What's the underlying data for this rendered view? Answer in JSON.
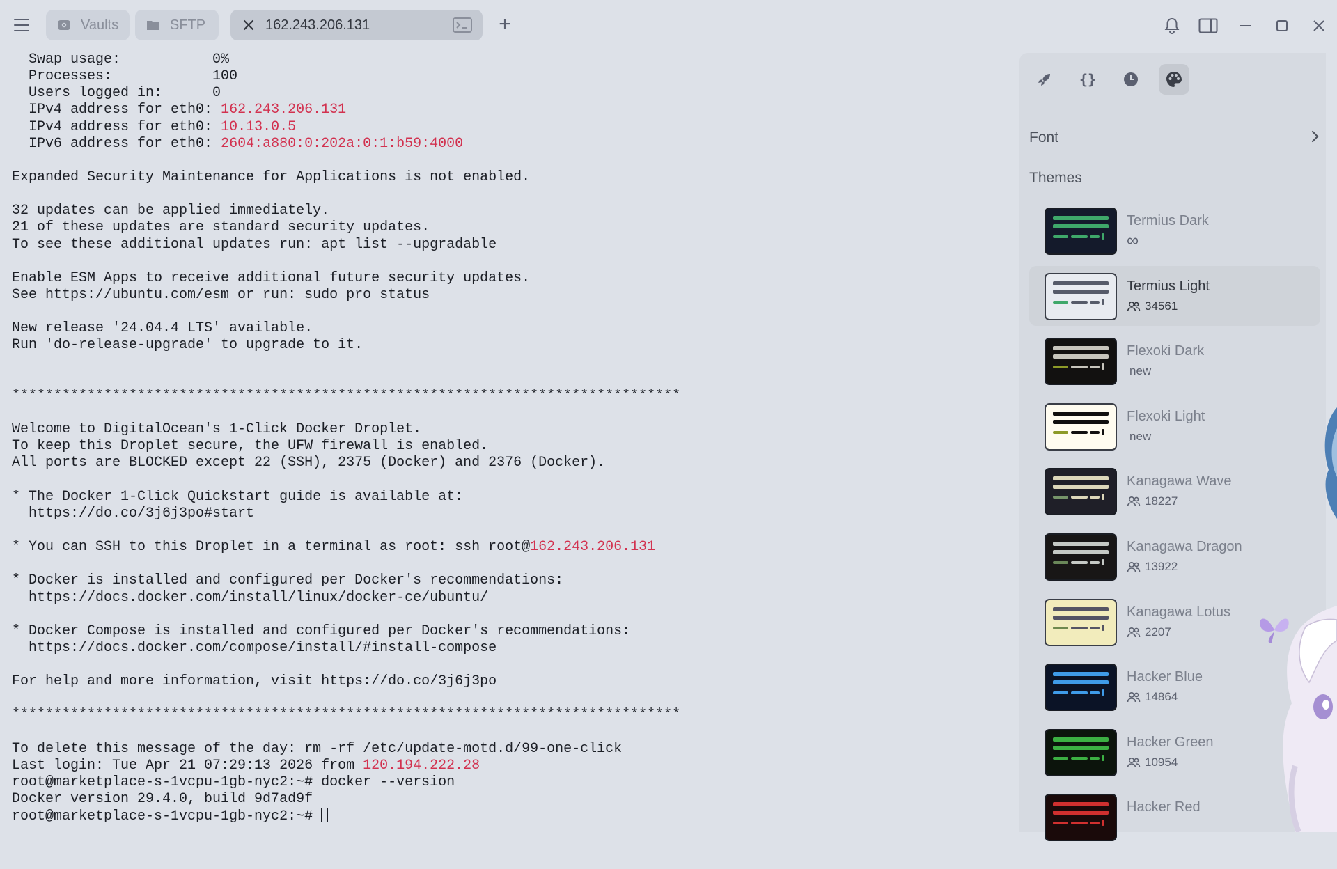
{
  "tabs": [
    {
      "label": "Vaults",
      "icon": "vault-icon"
    },
    {
      "label": "SFTP",
      "icon": "folder-icon"
    },
    {
      "label": "162.243.206.131",
      "icon": "close-icon"
    }
  ],
  "terminal": {
    "lines": [
      [
        {
          "t": "  Swap usage:           0%"
        }
      ],
      [
        {
          "t": "  Processes:            100"
        }
      ],
      [
        {
          "t": "  Users logged in:      0"
        }
      ],
      [
        {
          "t": "  IPv4 address for eth0: "
        },
        {
          "t": "162.243.206.131",
          "hl": true
        }
      ],
      [
        {
          "t": "  IPv4 address for eth0: "
        },
        {
          "t": "10.13.0.5",
          "hl": true
        }
      ],
      [
        {
          "t": "  IPv6 address for eth0: "
        },
        {
          "t": "2604:a880:0:202a:0:1:b59:4000",
          "hl": true
        }
      ],
      [
        {
          "t": ""
        }
      ],
      [
        {
          "t": "Expanded Security Maintenance for Applications is not enabled."
        }
      ],
      [
        {
          "t": ""
        }
      ],
      [
        {
          "t": "32 updates can be applied immediately."
        }
      ],
      [
        {
          "t": "21 of these updates are standard security updates."
        }
      ],
      [
        {
          "t": "To see these additional updates run: apt list --upgradable"
        }
      ],
      [
        {
          "t": ""
        }
      ],
      [
        {
          "t": "Enable ESM Apps to receive additional future security updates."
        }
      ],
      [
        {
          "t": "See https://ubuntu.com/esm or run: sudo pro status"
        }
      ],
      [
        {
          "t": ""
        }
      ],
      [
        {
          "t": "New release '24.04.4 LTS' available."
        }
      ],
      [
        {
          "t": "Run 'do-release-upgrade' to upgrade to it."
        }
      ],
      [
        {
          "t": ""
        }
      ],
      [
        {
          "t": ""
        }
      ],
      [
        {
          "t": "********************************************************************************"
        }
      ],
      [
        {
          "t": ""
        }
      ],
      [
        {
          "t": "Welcome to DigitalOcean's 1-Click Docker Droplet."
        }
      ],
      [
        {
          "t": "To keep this Droplet secure, the UFW firewall is enabled."
        }
      ],
      [
        {
          "t": "All ports are BLOCKED except 22 (SSH), 2375 (Docker) and 2376 (Docker)."
        }
      ],
      [
        {
          "t": ""
        }
      ],
      [
        {
          "t": "* The Docker 1-Click Quickstart guide is available at:"
        }
      ],
      [
        {
          "t": "  https://do.co/3j6j3po#start"
        }
      ],
      [
        {
          "t": ""
        }
      ],
      [
        {
          "t": "* You can SSH to this Droplet in a terminal as root: ssh root@"
        },
        {
          "t": "162.243.206.131",
          "hl": true
        }
      ],
      [
        {
          "t": ""
        }
      ],
      [
        {
          "t": "* Docker is installed and configured per Docker's recommendations:"
        }
      ],
      [
        {
          "t": "  https://docs.docker.com/install/linux/docker-ce/ubuntu/"
        }
      ],
      [
        {
          "t": ""
        }
      ],
      [
        {
          "t": "* Docker Compose is installed and configured per Docker's recommendations:"
        }
      ],
      [
        {
          "t": "  https://docs.docker.com/compose/install/#install-compose"
        }
      ],
      [
        {
          "t": ""
        }
      ],
      [
        {
          "t": "For help and more information, visit https://do.co/3j6j3po"
        }
      ],
      [
        {
          "t": ""
        }
      ],
      [
        {
          "t": "********************************************************************************"
        }
      ],
      [
        {
          "t": ""
        }
      ],
      [
        {
          "t": "To delete this message of the day: rm -rf /etc/update-motd.d/99-one-click"
        }
      ],
      [
        {
          "t": "Last login: Tue Apr 21 07:29:13 2026 from "
        },
        {
          "t": "120.194.222.28",
          "hl": true
        }
      ],
      [
        {
          "t": "root@marketplace-s-1vcpu-1gb-nyc2:~# docker --version"
        }
      ],
      [
        {
          "t": "Docker version 29.4.0, build 9d7ad9f"
        }
      ],
      [
        {
          "t": "root@marketplace-s-1vcpu-1gb-nyc2:~# "
        }
      ]
    ]
  },
  "panel": {
    "tabs": [
      "rocket-icon",
      "braces-icon",
      "clock-icon",
      "palette-icon"
    ],
    "font_label": "Font",
    "themes_title": "Themes",
    "themes": [
      {
        "name": "Termius Dark",
        "meta": "∞",
        "meta_type": "infinity",
        "bg": "#141a2b",
        "bar1": "#3fa86a",
        "bar2": "#3fa86a",
        "accent": "#3fa86a",
        "light": false
      },
      {
        "name": "Termius Light",
        "meta": "34561",
        "meta_type": "users",
        "bg": "#e8ebf0",
        "bar1": "#565b69",
        "bar2": "#565b69",
        "accent": "#3fa86a",
        "light": true,
        "selected": true
      },
      {
        "name": "Flexoki Dark",
        "meta": "new",
        "meta_type": "new",
        "bg": "#121110",
        "bar1": "#c7c5bc",
        "bar2": "#c7c5bc",
        "accent": "#8c9a28",
        "light": false
      },
      {
        "name": "Flexoki Light",
        "meta": "new",
        "meta_type": "new",
        "bg": "#fffcf0",
        "bar1": "#100f0f",
        "bar2": "#100f0f",
        "accent": "#8c9a28",
        "light": true
      },
      {
        "name": "Kanagawa Wave",
        "meta": "18227",
        "meta_type": "users",
        "bg": "#1f1f28",
        "bar1": "#dcd7ba",
        "bar2": "#dcd7ba",
        "accent": "#76946a",
        "light": false
      },
      {
        "name": "Kanagawa Dragon",
        "meta": "13922",
        "meta_type": "users",
        "bg": "#181616",
        "bar1": "#c5c9c5",
        "bar2": "#c5c9c5",
        "accent": "#6a8759",
        "light": false
      },
      {
        "name": "Kanagawa Lotus",
        "meta": "2207",
        "meta_type": "users",
        "bg": "#f2ecbc",
        "bar1": "#545464",
        "bar2": "#545464",
        "accent": "#6f894e",
        "light": true
      },
      {
        "name": "Hacker Blue",
        "meta": "14864",
        "meta_type": "users",
        "bg": "#0b1326",
        "bar1": "#3f9be8",
        "bar2": "#3f9be8",
        "accent": "#3f9be8",
        "light": false
      },
      {
        "name": "Hacker Green",
        "meta": "10954",
        "meta_type": "users",
        "bg": "#0c140c",
        "bar1": "#3cb043",
        "bar2": "#3cb043",
        "accent": "#3cb043",
        "light": false
      },
      {
        "name": "Hacker Red",
        "meta": "",
        "meta_type": "none",
        "bg": "#1a0a0a",
        "bar1": "#d0302f",
        "bar2": "#d0302f",
        "accent": "#d0302f",
        "light": false
      }
    ]
  },
  "colors": {
    "highlight": "#d2314f",
    "panel_bg": "#d6dae1",
    "window_bg": "#dde1e8"
  }
}
